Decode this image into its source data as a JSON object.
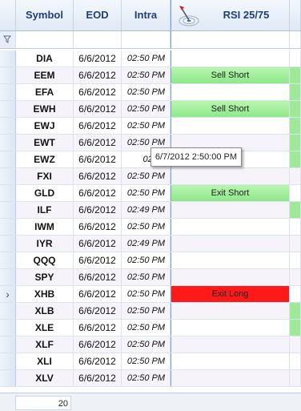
{
  "columns": {
    "symbol": "Symbol",
    "eod": "EOD",
    "intra": "Intra",
    "rsi": "RSI 25/75"
  },
  "rows": [
    {
      "symbol": "DIA",
      "eod": "6/6/2012",
      "intra": "02:50 PM",
      "rsi": "",
      "rsi_state": "none",
      "ext_state": "none"
    },
    {
      "symbol": "EEM",
      "eod": "6/6/2012",
      "intra": "02:50 PM",
      "rsi": "Sell Short",
      "rsi_state": "green",
      "ext_state": "green"
    },
    {
      "symbol": "EFA",
      "eod": "6/6/2012",
      "intra": "02:50 PM",
      "rsi": "",
      "rsi_state": "none",
      "ext_state": "green"
    },
    {
      "symbol": "EWH",
      "eod": "6/6/2012",
      "intra": "02:50 PM",
      "rsi": "Sell Short",
      "rsi_state": "green",
      "ext_state": "green"
    },
    {
      "symbol": "EWJ",
      "eod": "6/6/2012",
      "intra": "02:50 PM",
      "rsi": "",
      "rsi_state": "none",
      "ext_state": "green"
    },
    {
      "symbol": "EWT",
      "eod": "6/6/2012",
      "intra": "02:50 PM",
      "rsi": "",
      "rsi_state": "none",
      "ext_state": "green"
    },
    {
      "symbol": "EWZ",
      "eod": "6/6/2012",
      "intra": "02:50",
      "rsi": "",
      "rsi_state": "none",
      "ext_state": "green"
    },
    {
      "symbol": "FXI",
      "eod": "6/6/2012",
      "intra": "02:50 PM",
      "rsi": "",
      "rsi_state": "none",
      "ext_state": "none"
    },
    {
      "symbol": "GLD",
      "eod": "6/6/2012",
      "intra": "02:50 PM",
      "rsi": "Exit Short",
      "rsi_state": "green",
      "ext_state": "none"
    },
    {
      "symbol": "ILF",
      "eod": "6/6/2012",
      "intra": "02:49 PM",
      "rsi": "",
      "rsi_state": "none",
      "ext_state": "green"
    },
    {
      "symbol": "IWM",
      "eod": "6/6/2012",
      "intra": "02:50 PM",
      "rsi": "",
      "rsi_state": "none",
      "ext_state": "none"
    },
    {
      "symbol": "IYR",
      "eod": "6/6/2012",
      "intra": "02:49 PM",
      "rsi": "",
      "rsi_state": "none",
      "ext_state": "none"
    },
    {
      "symbol": "QQQ",
      "eod": "6/6/2012",
      "intra": "02:50 PM",
      "rsi": "",
      "rsi_state": "none",
      "ext_state": "none"
    },
    {
      "symbol": "SPY",
      "eod": "6/6/2012",
      "intra": "02:50 PM",
      "rsi": "",
      "rsi_state": "none",
      "ext_state": "none"
    },
    {
      "symbol": "XHB",
      "eod": "6/6/2012",
      "intra": "02:50 PM",
      "rsi": "Exit Long",
      "rsi_state": "red",
      "ext_state": "none",
      "current": true
    },
    {
      "symbol": "XLB",
      "eod": "6/6/2012",
      "intra": "02:50 PM",
      "rsi": "",
      "rsi_state": "none",
      "ext_state": "green"
    },
    {
      "symbol": "XLE",
      "eod": "6/6/2012",
      "intra": "02:50 PM",
      "rsi": "",
      "rsi_state": "none",
      "ext_state": "green"
    },
    {
      "symbol": "XLF",
      "eod": "6/6/2012",
      "intra": "02:50 PM",
      "rsi": "",
      "rsi_state": "none",
      "ext_state": "none"
    },
    {
      "symbol": "XLI",
      "eod": "6/6/2012",
      "intra": "02:50 PM",
      "rsi": "",
      "rsi_state": "none",
      "ext_state": "none"
    },
    {
      "symbol": "XLV",
      "eod": "6/6/2012",
      "intra": "02:50 PM",
      "rsi": "",
      "rsi_state": "none",
      "ext_state": "none"
    }
  ],
  "tooltip": "6/7/2012 2:50:00 PM",
  "footer": {
    "count": "20"
  },
  "icons": {
    "filter": "funnel-icon",
    "rsi": "target-dart-icon",
    "current_row": "row-pointer-icon"
  },
  "colors": {
    "signal_green": "#8fe88a",
    "signal_red": "#ff1a1a",
    "header_text": "#1f3f7a"
  }
}
